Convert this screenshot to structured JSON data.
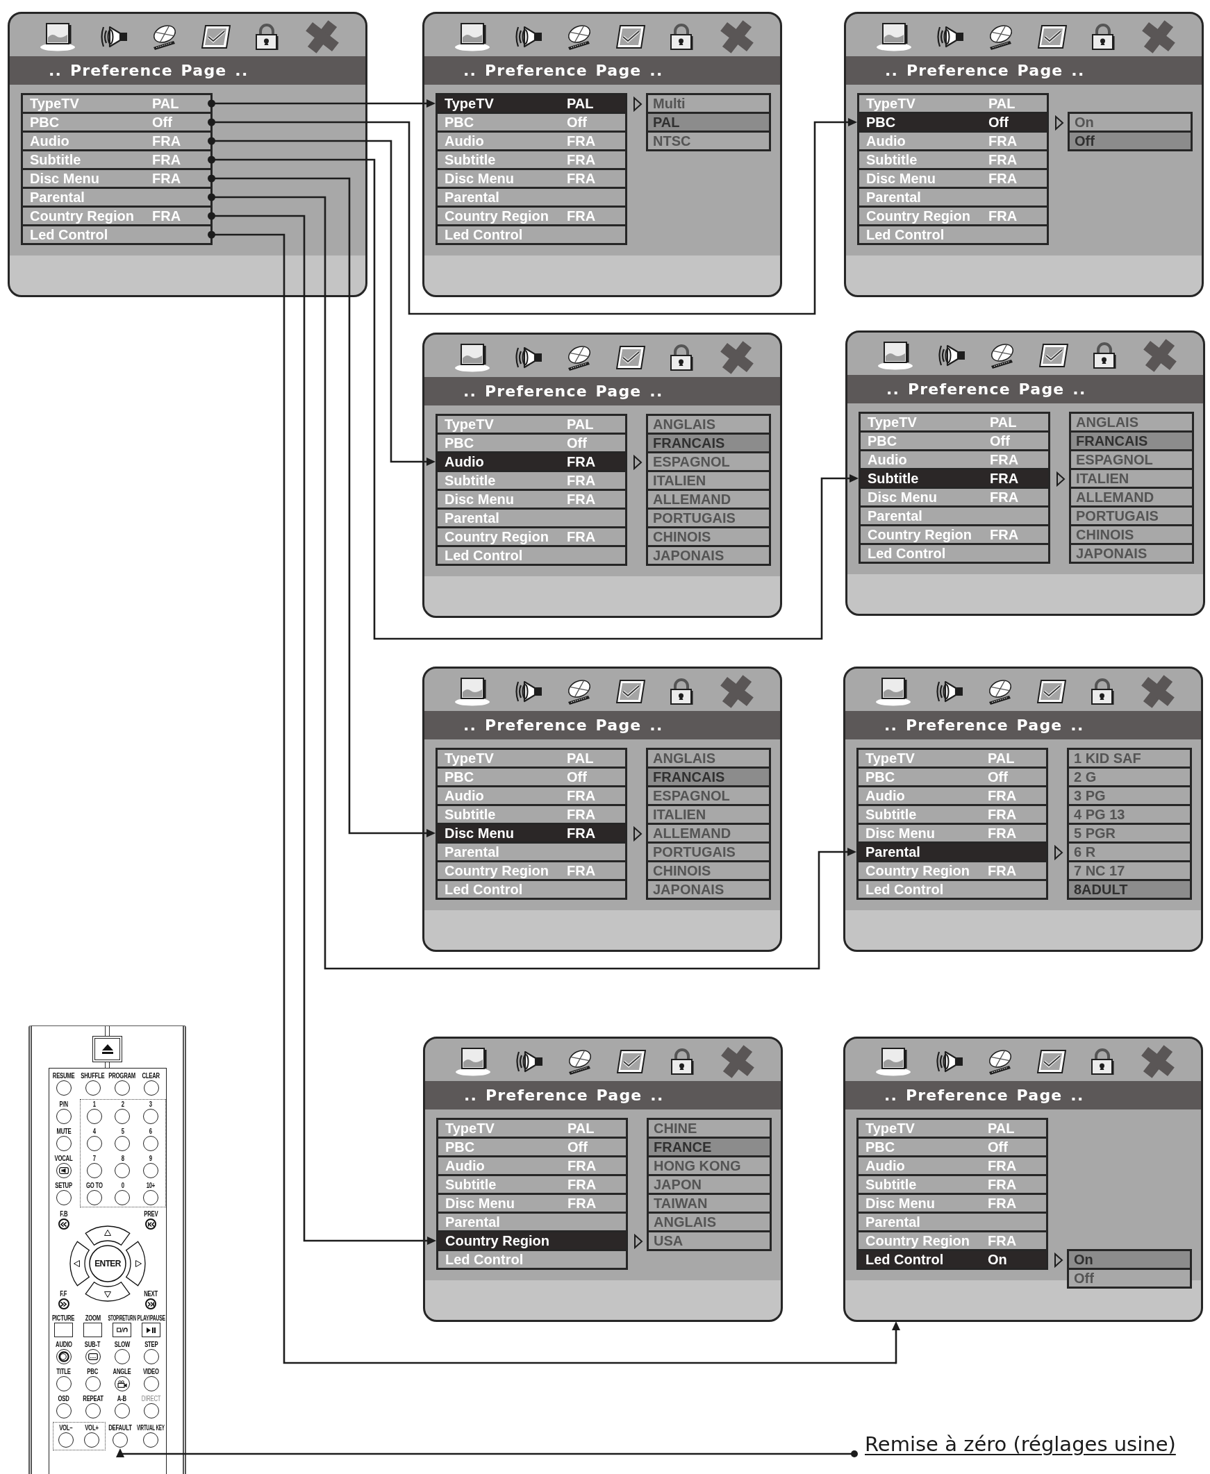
{
  "panels": [
    {
      "title": ".. Preference Page ..",
      "rows": [
        {
          "label": "TypeTV",
          "value": "PAL",
          "selected": false
        },
        {
          "label": "PBC",
          "value": "Off",
          "selected": false
        },
        {
          "label": "Audio",
          "value": "FRA",
          "selected": false
        },
        {
          "label": "Subtitle",
          "value": "FRA",
          "selected": false
        },
        {
          "label": "Disc Menu",
          "value": "FRA",
          "selected": false
        },
        {
          "label": "Parental",
          "selected": false
        },
        {
          "label": "Country Region",
          "value": "FRA",
          "selected": false
        },
        {
          "label": "Led Control",
          "selected": false
        }
      ]
    },
    {
      "title": ".. Preference Page ..",
      "rows": [
        {
          "label": "TypeTV",
          "value": "PAL",
          "selected": true
        },
        {
          "label": "PBC",
          "value": "Off",
          "selected": false
        },
        {
          "label": "Audio",
          "value": "FRA",
          "selected": false
        },
        {
          "label": "Subtitle",
          "value": "FRA",
          "selected": false
        },
        {
          "label": "Disc Menu",
          "value": "FRA",
          "selected": false
        },
        {
          "label": "Parental",
          "selected": false
        },
        {
          "label": "Country Region",
          "value": "FRA",
          "selected": false
        },
        {
          "label": "Led Control",
          "selected": false
        }
      ],
      "submenu": [
        {
          "label": "Multi",
          "selected": false
        },
        {
          "label": "PAL",
          "selected": true
        },
        {
          "label": "NTSC",
          "selected": false
        }
      ]
    },
    {
      "title": ".. Preference Page ..",
      "rows": [
        {
          "label": "TypeTV",
          "value": "PAL",
          "selected": false
        },
        {
          "label": "PBC",
          "value": "Off",
          "selected": true
        },
        {
          "label": "Audio",
          "value": "FRA",
          "selected": false
        },
        {
          "label": "Subtitle",
          "value": "FRA",
          "selected": false
        },
        {
          "label": "Disc Menu",
          "value": "FRA",
          "selected": false
        },
        {
          "label": "Parental",
          "selected": false
        },
        {
          "label": "Country Region",
          "value": "FRA",
          "selected": false
        },
        {
          "label": "Led Control",
          "selected": false
        }
      ],
      "submenu": [
        {
          "label": "On",
          "selected": false
        },
        {
          "label": "Off",
          "selected": true
        }
      ]
    },
    {
      "title": ".. Preference Page ..",
      "rows": [
        {
          "label": "TypeTV",
          "value": "PAL",
          "selected": false
        },
        {
          "label": "PBC",
          "value": "Off",
          "selected": false
        },
        {
          "label": "Audio",
          "value": "FRA",
          "selected": true
        },
        {
          "label": "Subtitle",
          "value": "FRA",
          "selected": false
        },
        {
          "label": "Disc Menu",
          "value": "FRA",
          "selected": false
        },
        {
          "label": "Parental",
          "selected": false
        },
        {
          "label": "Country Region",
          "value": "FRA",
          "selected": false
        },
        {
          "label": "Led Control",
          "selected": false
        }
      ],
      "submenu": [
        {
          "label": "ANGLAIS",
          "selected": false
        },
        {
          "label": "FRANCAIS",
          "selected": true
        },
        {
          "label": "ESPAGNOL",
          "selected": false
        },
        {
          "label": "ITALIEN",
          "selected": false
        },
        {
          "label": "ALLEMAND",
          "selected": false
        },
        {
          "label": "PORTUGAIS",
          "selected": false
        },
        {
          "label": "CHINOIS",
          "selected": false
        },
        {
          "label": "JAPONAIS",
          "selected": false
        }
      ]
    },
    {
      "title": ".. Preference Page ..",
      "rows": [
        {
          "label": "TypeTV",
          "value": "PAL",
          "selected": false
        },
        {
          "label": "PBC",
          "value": "Off",
          "selected": false
        },
        {
          "label": "Audio",
          "value": "FRA",
          "selected": false
        },
        {
          "label": "Subtitle",
          "value": "FRA",
          "selected": true
        },
        {
          "label": "Disc Menu",
          "value": "FRA",
          "selected": false
        },
        {
          "label": "Parental",
          "selected": false
        },
        {
          "label": "Country Region",
          "value": "FRA",
          "selected": false
        },
        {
          "label": "Led Control",
          "selected": false
        }
      ],
      "submenu": [
        {
          "label": "ANGLAIS",
          "selected": false
        },
        {
          "label": "FRANCAIS",
          "selected": true
        },
        {
          "label": "ESPAGNOL",
          "selected": false
        },
        {
          "label": "ITALIEN",
          "selected": false
        },
        {
          "label": "ALLEMAND",
          "selected": false
        },
        {
          "label": "PORTUGAIS",
          "selected": false
        },
        {
          "label": "CHINOIS",
          "selected": false
        },
        {
          "label": "JAPONAIS",
          "selected": false
        }
      ]
    },
    {
      "title": ".. Preference Page ..",
      "rows": [
        {
          "label": "TypeTV",
          "value": "PAL",
          "selected": false
        },
        {
          "label": "PBC",
          "value": "Off",
          "selected": false
        },
        {
          "label": "Audio",
          "value": "FRA",
          "selected": false
        },
        {
          "label": "Subtitle",
          "value": "FRA",
          "selected": false
        },
        {
          "label": "Disc Menu",
          "value": "FRA",
          "selected": true
        },
        {
          "label": "Parental",
          "selected": false
        },
        {
          "label": "Country Region",
          "value": "FRA",
          "selected": false
        },
        {
          "label": "Led Control",
          "selected": false
        }
      ],
      "submenu": [
        {
          "label": "ANGLAIS",
          "selected": false
        },
        {
          "label": "FRANCAIS",
          "selected": true
        },
        {
          "label": "ESPAGNOL",
          "selected": false
        },
        {
          "label": "ITALIEN",
          "selected": false
        },
        {
          "label": "ALLEMAND",
          "selected": false
        },
        {
          "label": "PORTUGAIS",
          "selected": false
        },
        {
          "label": "CHINOIS",
          "selected": false
        },
        {
          "label": "JAPONAIS",
          "selected": false
        }
      ]
    },
    {
      "title": ".. Preference Page ..",
      "rows": [
        {
          "label": "TypeTV",
          "value": "PAL",
          "selected": false
        },
        {
          "label": "PBC",
          "value": "Off",
          "selected": false
        },
        {
          "label": "Audio",
          "value": "FRA",
          "selected": false
        },
        {
          "label": "Subtitle",
          "value": "FRA",
          "selected": false
        },
        {
          "label": "Disc Menu",
          "value": "FRA",
          "selected": false
        },
        {
          "label": "Parental",
          "selected": true
        },
        {
          "label": "Country Region",
          "value": "FRA",
          "selected": false
        },
        {
          "label": "Led Control",
          "selected": false
        }
      ],
      "submenu": [
        {
          "label": "1 KID SAF",
          "selected": false
        },
        {
          "label": "2 G",
          "selected": false
        },
        {
          "label": "3 PG",
          "selected": false
        },
        {
          "label": "4 PG 13",
          "selected": false
        },
        {
          "label": "5 PGR",
          "selected": false
        },
        {
          "label": "6 R",
          "selected": false
        },
        {
          "label": "7 NC 17",
          "selected": false
        },
        {
          "label": "8ADULT",
          "selected": true
        }
      ]
    },
    {
      "title": ".. Preference Page ..",
      "rows": [
        {
          "label": "TypeTV",
          "value": "PAL",
          "selected": false
        },
        {
          "label": "PBC",
          "value": "Off",
          "selected": false
        },
        {
          "label": "Audio",
          "value": "FRA",
          "selected": false
        },
        {
          "label": "Subtitle",
          "value": "FRA",
          "selected": false
        },
        {
          "label": "Disc Menu",
          "value": "FRA",
          "selected": false
        },
        {
          "label": "Parental",
          "selected": false
        },
        {
          "label": "Country Region",
          "selected": true
        },
        {
          "label": "Led Control",
          "selected": false
        }
      ],
      "submenu": [
        {
          "label": "CHINE",
          "selected": false
        },
        {
          "label": "FRANCE",
          "selected": true
        },
        {
          "label": "HONG KONG",
          "selected": false
        },
        {
          "label": "JAPON",
          "selected": false
        },
        {
          "label": "TAIWAN",
          "selected": false
        },
        {
          "label": "ANGLAIS",
          "selected": false
        },
        {
          "label": "USA",
          "selected": false
        }
      ]
    },
    {
      "title": ".. Preference Page ..",
      "rows": [
        {
          "label": "TypeTV",
          "value": "PAL",
          "selected": false
        },
        {
          "label": "PBC",
          "value": "Off",
          "selected": false
        },
        {
          "label": "Audio",
          "value": "FRA",
          "selected": false
        },
        {
          "label": "Subtitle",
          "value": "FRA",
          "selected": false
        },
        {
          "label": "Disc Menu",
          "value": "FRA",
          "selected": false
        },
        {
          "label": "Parental",
          "selected": false
        },
        {
          "label": "Country Region",
          "value": "FRA",
          "selected": false
        },
        {
          "label": "Led Control",
          "value": "On",
          "selected": true
        }
      ],
      "submenu": [
        {
          "label": "On",
          "selected": true
        },
        {
          "label": "Off",
          "selected": false
        }
      ]
    }
  ],
  "remote": {
    "key_rows": [
      {
        "kind": "grid",
        "keys": [
          {
            "label": "RESUME",
            "kind": "round",
            "disabled": false
          },
          {
            "label": "SHUFFLE",
            "kind": "round",
            "disabled": false
          },
          {
            "label": "PROGRAM",
            "kind": "round",
            "disabled": false
          },
          {
            "label": "CLEAR",
            "kind": "round",
            "disabled": false
          }
        ]
      },
      {
        "kind": "pad",
        "keys": [
          {
            "label": "P/N",
            "kind": "round",
            "disabled": false
          },
          {
            "label": "1",
            "kind": "round",
            "disabled": false
          },
          {
            "label": "2",
            "kind": "round",
            "disabled": false
          },
          {
            "label": "3",
            "kind": "round",
            "disabled": false
          }
        ]
      },
      {
        "kind": "pad",
        "keys": [
          {
            "label": "MUTE",
            "kind": "round",
            "disabled": false
          },
          {
            "label": "4",
            "kind": "round",
            "disabled": false
          },
          {
            "label": "5",
            "kind": "round",
            "disabled": false
          },
          {
            "label": "6",
            "kind": "round",
            "disabled": false
          }
        ]
      },
      {
        "kind": "pad",
        "keys": [
          {
            "label": "VOCAL",
            "kind": "vocal",
            "disabled": false
          },
          {
            "label": "7",
            "kind": "round",
            "disabled": false
          },
          {
            "label": "8",
            "kind": "round",
            "disabled": false
          },
          {
            "label": "9",
            "kind": "round",
            "disabled": false
          }
        ]
      },
      {
        "kind": "pad",
        "keys": [
          {
            "label": "SETUP",
            "kind": "round",
            "disabled": false
          },
          {
            "label": "GO TO",
            "kind": "round",
            "disabled": false
          },
          {
            "label": "0",
            "kind": "round",
            "disabled": false
          },
          {
            "label": "10+",
            "kind": "round",
            "disabled": false
          }
        ]
      },
      {
        "kind": "nav",
        "center": "ENTER",
        "keys": [
          {
            "label": "F.B",
            "kind": "rewind",
            "disabled": false
          },
          {
            "label": "PREV",
            "kind": "prev",
            "disabled": false
          },
          {
            "label": "F.F",
            "kind": "forward",
            "disabled": false
          },
          {
            "label": "NEXT",
            "kind": "next",
            "disabled": false
          }
        ]
      },
      {
        "kind": "grid",
        "keys": [
          {
            "label": "PICTURE",
            "kind": "square",
            "disabled": false
          },
          {
            "label": "ZOOM",
            "kind": "square",
            "disabled": false
          },
          {
            "label": "STOP/RETURN",
            "kind": "stop-return",
            "disabled": false
          },
          {
            "label": "PLAY/PAUSE",
            "kind": "play-pause",
            "disabled": false
          }
        ]
      },
      {
        "kind": "grid",
        "keys": [
          {
            "label": "AUDIO",
            "kind": "audio",
            "disabled": false
          },
          {
            "label": "SUB-T",
            "kind": "subtitle",
            "disabled": false
          },
          {
            "label": "SLOW",
            "kind": "round",
            "disabled": false
          },
          {
            "label": "STEP",
            "kind": "round",
            "disabled": false
          }
        ]
      },
      {
        "kind": "grid",
        "keys": [
          {
            "label": "TITLE",
            "kind": "round",
            "disabled": false
          },
          {
            "label": "PBC",
            "kind": "round",
            "disabled": false
          },
          {
            "label": "ANGLE",
            "kind": "angle",
            "disabled": false
          },
          {
            "label": "VIDEO",
            "kind": "round",
            "disabled": false
          }
        ]
      },
      {
        "kind": "grid",
        "keys": [
          {
            "label": "OSD",
            "kind": "round",
            "disabled": false
          },
          {
            "label": "REPEAT",
            "kind": "round",
            "disabled": false
          },
          {
            "label": "A-B",
            "kind": "round",
            "disabled": false
          },
          {
            "label": "DIRECT",
            "kind": "round",
            "disabled": true
          }
        ]
      },
      {
        "kind": "volume",
        "keys": [
          {
            "label": "VOL–",
            "kind": "round",
            "disabled": false
          },
          {
            "label": "VOL+",
            "kind": "round",
            "disabled": false
          },
          {
            "label": "DEFAULT",
            "kind": "round",
            "disabled": false
          },
          {
            "label": "VIRTUAL KEY",
            "kind": "round",
            "disabled": false
          }
        ]
      }
    ]
  },
  "caption": "Remise à zéro (réglages usine)"
}
